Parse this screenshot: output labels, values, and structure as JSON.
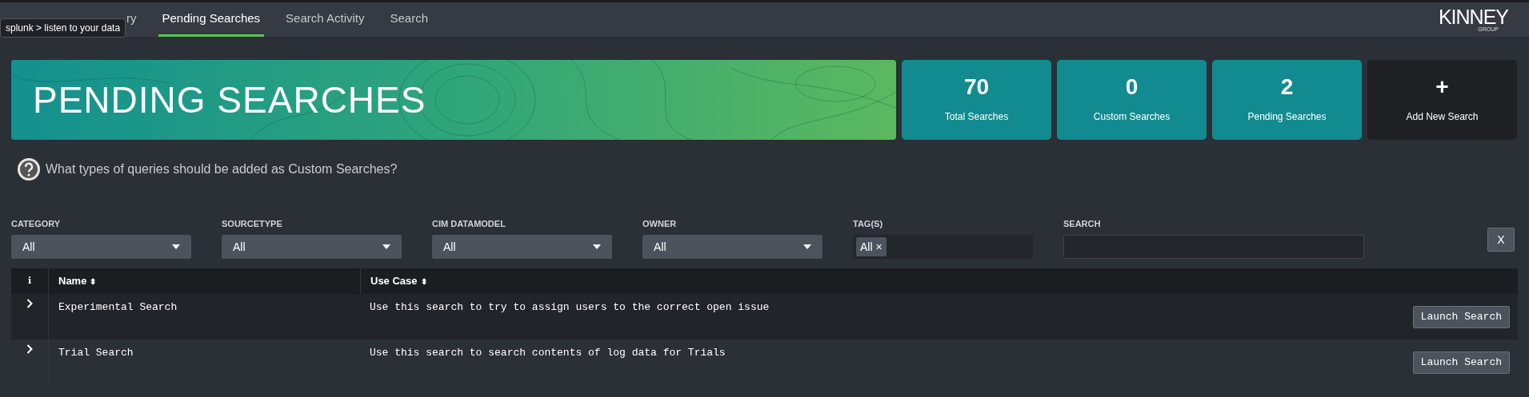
{
  "nav": {
    "tooltip": "splunk > listen to your data",
    "tabs": [
      {
        "label": "ry",
        "selected": false
      },
      {
        "label": "Pending Searches",
        "selected": true
      },
      {
        "label": "Search Activity",
        "selected": false
      },
      {
        "label": "Search",
        "selected": false
      }
    ],
    "logo": {
      "name": "KINNEY",
      "sub": "GROUP"
    }
  },
  "banner": {
    "title": "PENDING SEARCHES"
  },
  "stats": [
    {
      "kind": "stat",
      "value": "70",
      "label": "Total Searches"
    },
    {
      "kind": "stat",
      "value": "0",
      "label": "Custom Searches"
    },
    {
      "kind": "stat",
      "value": "2",
      "label": "Pending Searches"
    },
    {
      "kind": "action",
      "value": "+",
      "label": "Add New Search"
    }
  ],
  "help": "What types of queries should be added as Custom Searches?",
  "filters": [
    {
      "kind": "dropdown",
      "label": "CATEGORY",
      "value": "All"
    },
    {
      "kind": "dropdown",
      "label": "SOURCETYPE",
      "value": "All"
    },
    {
      "kind": "dropdown",
      "label": "CIM DATAMODEL",
      "value": "All"
    },
    {
      "kind": "dropdown",
      "label": "OWNER",
      "value": "All"
    },
    {
      "kind": "tags",
      "label": "TAG(S)",
      "value": "All",
      "remove": "×"
    },
    {
      "kind": "text",
      "label": "SEARCH"
    }
  ],
  "clear_button": "X",
  "table": {
    "columns": [
      "i",
      "Name",
      "Use Case"
    ],
    "sort_icon": "⬍",
    "rows": [
      {
        "name": "Experimental Search",
        "use_case": "Use this search to try to assign users to the correct open issue",
        "button": "Launch Search"
      },
      {
        "name": "Trial Search",
        "use_case": "Use this search to search contents of log data for Trials",
        "button": "Launch Search"
      }
    ]
  }
}
